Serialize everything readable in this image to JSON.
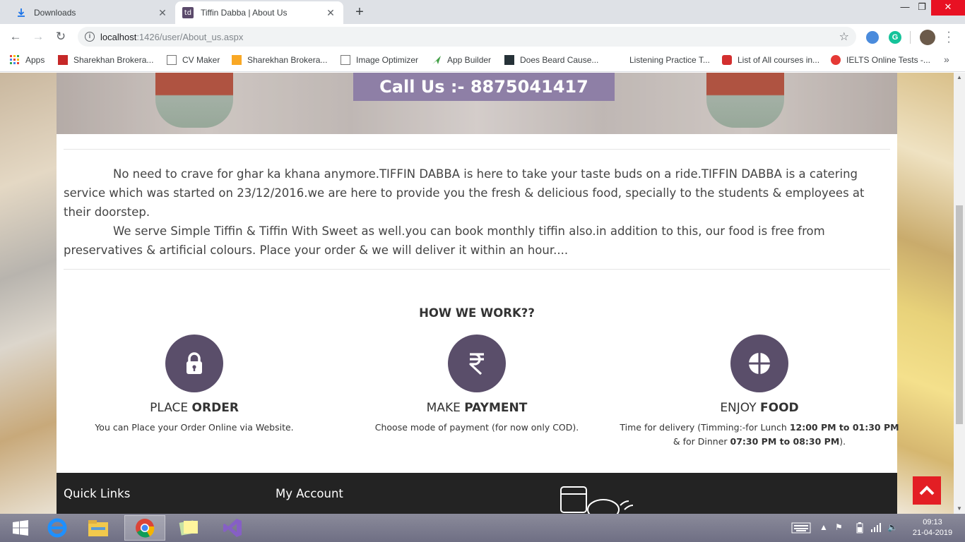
{
  "browser": {
    "tabs": [
      {
        "title": "Downloads",
        "icon": "download-icon",
        "active": false
      },
      {
        "title": "Tiffin Dabba | About Us",
        "icon": "td",
        "active": true
      }
    ],
    "url_host": "localhost",
    "url_path": ":1426/user/About_us.aspx",
    "bookmarks": [
      {
        "label": "Apps",
        "icon": "apps-grid-icon"
      },
      {
        "label": "Sharekhan Brokera...",
        "icon": "sharekhan-icon"
      },
      {
        "label": "CV Maker",
        "icon": "page-icon"
      },
      {
        "label": "Sharekhan Brokera...",
        "icon": "sharekhan-icon"
      },
      {
        "label": "Image Optimizer",
        "icon": "page-icon"
      },
      {
        "label": "App Builder",
        "icon": "app-builder-icon"
      },
      {
        "label": "Does Beard Cause...",
        "icon": "site-icon"
      },
      {
        "label": "Listening Practice T...",
        "icon": "none"
      },
      {
        "label": "List of All courses in...",
        "icon": "site-icon"
      },
      {
        "label": "IELTS Online Tests -...",
        "icon": "site-icon"
      }
    ]
  },
  "page": {
    "banner": {
      "call_text": "Call Us :- 8875041417"
    },
    "about": {
      "paragraph1": "No need to crave for ghar ka khana anymore.TIFFIN DABBA is here to take your taste buds on a ride.TIFFIN DABBA is a catering service which was started on 23/12/2016.we are here to provide you the fresh & delicious food, specially to the students & employees at their doorstep.",
      "paragraph2": "We serve Simple Tiffin & Tiffin With Sweet as well.you can book monthly tiffin also.in addition to this, our food is free from preservatives & artificial colours. Place your order & we will deliver it within an hour...."
    },
    "how_we_work": {
      "title": "HOW WE WORK??",
      "steps": [
        {
          "icon": "lock-icon",
          "head_light": "PLACE ",
          "head_bold": "ORDER",
          "desc": "You can Place your Order Online via Website."
        },
        {
          "icon": "rupee-icon",
          "head_light": "MAKE ",
          "head_bold": "PAYMENT",
          "desc": "Choose mode of payment (for now only COD)."
        },
        {
          "icon": "plate-icon",
          "head_light": "ENJOY ",
          "head_bold": "FOOD",
          "desc_parts": [
            "Time for delivery (Timming:-for Lunch ",
            "12:00 PM to 01:30 PM",
            " & for Dinner ",
            "07:30 PM to 08:30 PM",
            ")."
          ]
        }
      ]
    },
    "footer": {
      "quick_links": "Quick Links",
      "my_account": "My Account"
    }
  },
  "taskbar": {
    "time": "09:13",
    "date": "21-04-2019"
  },
  "colors": {
    "accent_purple": "#5a4e6a",
    "call_box": "#8e7fa6",
    "footer_bg": "#232323",
    "scroll_top_red": "#e31e24"
  }
}
